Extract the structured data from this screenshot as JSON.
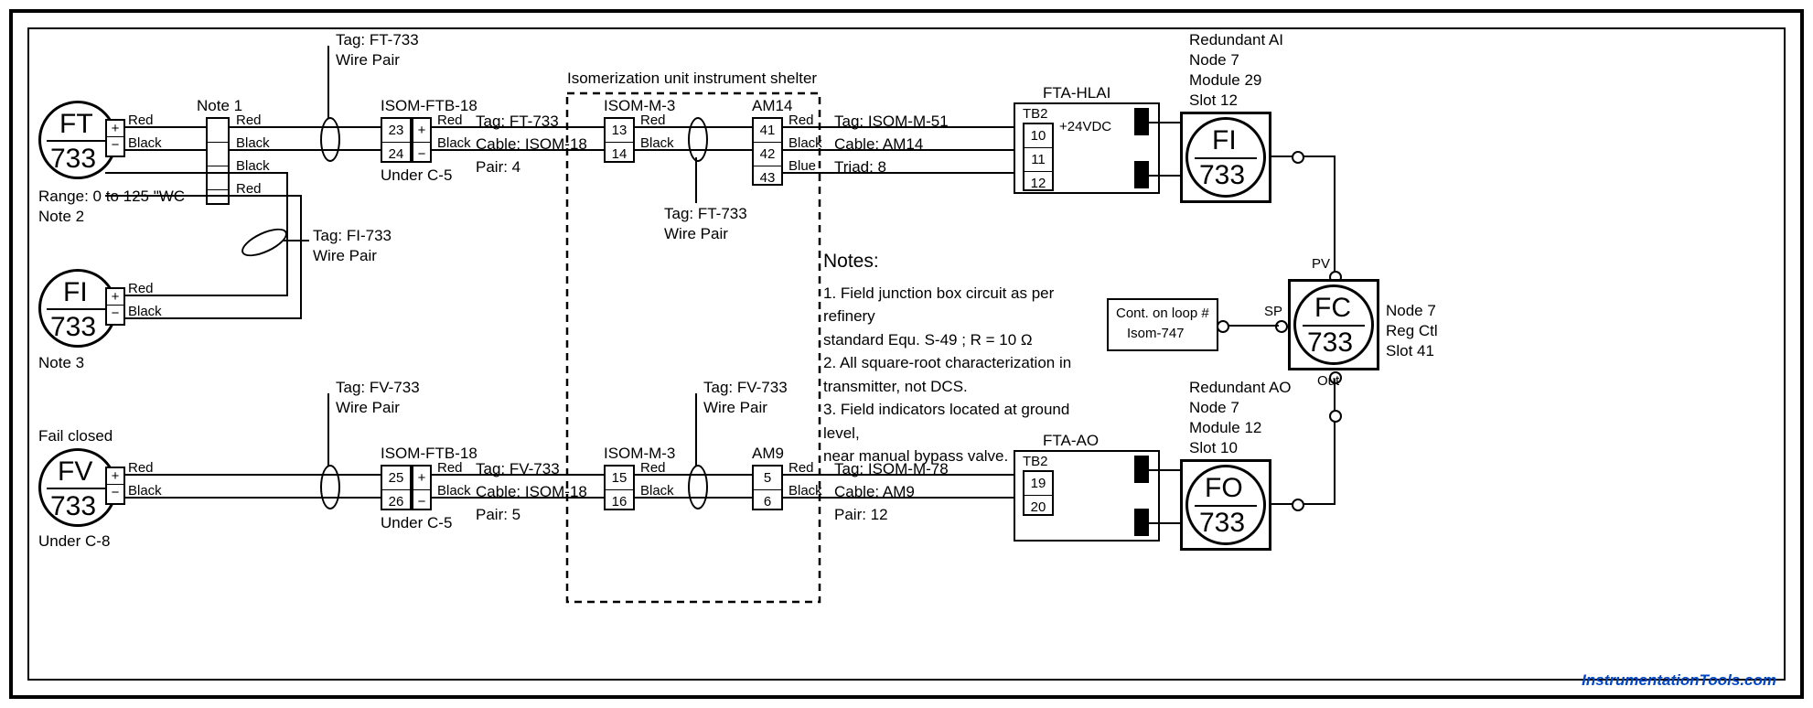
{
  "shelter_label": "Isomerization unit instrument shelter",
  "ft": {
    "tag1": "FT",
    "tag2": "733",
    "range": "Range: 0 to 125 \"WC",
    "note": "Note 2",
    "red": "Red",
    "black": "Black"
  },
  "fi": {
    "tag1": "FI",
    "tag2": "733",
    "note": "Note 3",
    "red": "Red",
    "black": "Black"
  },
  "fv": {
    "tag1": "FV",
    "tag2": "733",
    "fail": "Fail closed",
    "under": "Under C-8",
    "red": "Red",
    "black": "Black"
  },
  "jb": {
    "note": "Note 1",
    "r": "Red",
    "b": "Black"
  },
  "wp": {
    "ft": {
      "l1": "Tag: FT-733",
      "l2": "Wire Pair"
    },
    "fi": {
      "l1": "Tag: FI-733",
      "l2": "Wire Pair"
    },
    "fv": {
      "l1": "Tag: FV-733",
      "l2": "Wire Pair"
    },
    "ft2": {
      "l1": "Tag: FT-733",
      "l2": "Wire Pair"
    },
    "fv2": {
      "l1": "Tag: FV-733",
      "l2": "Wire Pair"
    }
  },
  "ftb": {
    "name": "ISOM-FTB-18",
    "under": "Under C-5",
    "a": {
      "t1": "23",
      "t2": "24",
      "r": "Red",
      "b": "Black",
      "info1": "Tag: FT-733",
      "info2": "Cable: ISOM-18",
      "info3": "Pair: 4"
    },
    "b": {
      "t1": "25",
      "t2": "26",
      "r": "Red",
      "b": "Black",
      "info1": "Tag: FV-733",
      "info2": "Cable: ISOM-18",
      "info3": "Pair: 5"
    }
  },
  "isomm": {
    "name": "ISOM-M-3",
    "a": {
      "t1": "13",
      "t2": "14",
      "r": "Red",
      "b": "Black"
    },
    "b": {
      "t1": "15",
      "t2": "16",
      "r": "Red",
      "b": "Black"
    }
  },
  "am14": {
    "name": "AM14",
    "t1": "41",
    "t2": "42",
    "t3": "43",
    "r": "Red",
    "b": "Black",
    "bl": "Blue",
    "info1": "Tag: ISOM-M-51",
    "info2": "Cable: AM14",
    "info3": "Triad: 8"
  },
  "am9": {
    "name": "AM9",
    "t1": "5",
    "t2": "6",
    "r": "Red",
    "b": "Black",
    "info1": "Tag: ISOM-M-78",
    "info2": "Cable: AM9",
    "info3": "Pair: 12"
  },
  "hlai": {
    "name": "FTA-HLAI",
    "tb": "TB2",
    "t1": "10",
    "t2": "11",
    "t3": "12",
    "v": "+24VDC"
  },
  "ao": {
    "name": "FTA-AO",
    "tb": "TB2",
    "t1": "19",
    "t2": "20"
  },
  "ai": {
    "l1": "Redundant AI",
    "l2": "Node 7",
    "l3": "Module 29",
    "l4": "Slot 12",
    "tag1": "FI",
    "tag2": "733"
  },
  "aom": {
    "l1": "Redundant AO",
    "l2": "Node 7",
    "l3": "Module 12",
    "l4": "Slot 10",
    "tag1": "FO",
    "tag2": "733"
  },
  "fc": {
    "tag1": "FC",
    "tag2": "733",
    "pv": "PV",
    "sp": "SP",
    "out": "Out",
    "l1": "Node 7",
    "l2": "Reg Ctl",
    "l3": "Slot 41"
  },
  "cont": {
    "l1": "Cont. on loop #",
    "l2": "Isom-747"
  },
  "notes": {
    "hd": "Notes:",
    "n1": "1. Field junction box circuit as per refinery",
    "n1b": "    standard Equ. S-49 ; R = 10 Ω",
    "n2": "2. All square-root characterization in",
    "n2b": "    transmitter, not DCS.",
    "n3": "3. Field indicators located at ground level,",
    "n3b": "    near manual bypass valve."
  },
  "credit": "InstrumentationTools.com",
  "sym": {
    "plus": "+",
    "minus": "−"
  }
}
